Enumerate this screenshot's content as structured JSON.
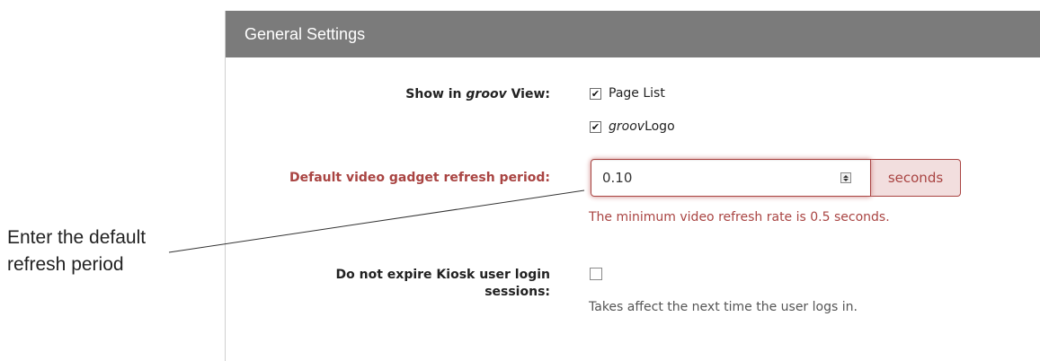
{
  "panel": {
    "title": "General Settings"
  },
  "show_in_view": {
    "label_prefix": "Show in ",
    "label_brand": "groov",
    "label_suffix": " View:",
    "options": [
      {
        "label": "Page List",
        "checked": true
      },
      {
        "brand": "groov",
        "label": " Logo",
        "checked": true
      }
    ]
  },
  "refresh_period": {
    "label": "Default video gadget refresh period:",
    "value": "0.10",
    "unit": "seconds",
    "error": "The minimum video refresh rate is 0.5 seconds."
  },
  "kiosk": {
    "label_line1": "Do not expire Kiosk user login",
    "label_line2": "sessions:",
    "checked": false,
    "help": "Takes affect the next time the user logs in."
  },
  "annotation": {
    "line1": "Enter the default",
    "line2": "refresh period"
  },
  "colors": {
    "header_bg": "#7b7b7b",
    "error": "#a94442",
    "error_bg": "#f2dede"
  }
}
